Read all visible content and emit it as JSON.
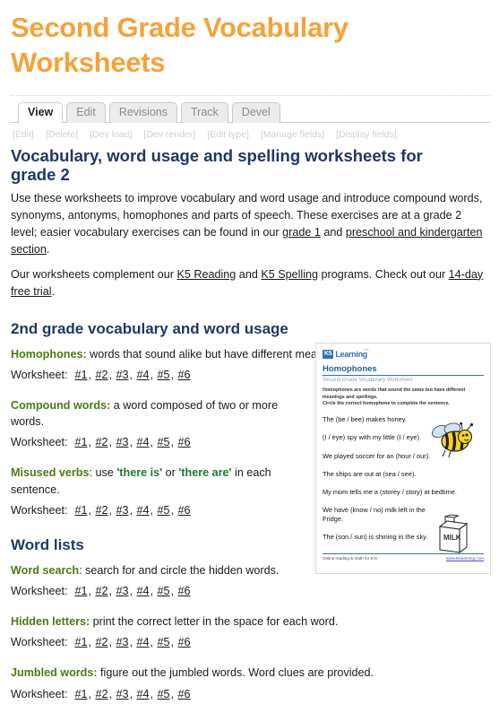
{
  "page_title": "Second Grade Vocabulary Worksheets",
  "tabs": [
    {
      "label": "View",
      "active": true
    },
    {
      "label": "Edit",
      "active": false
    },
    {
      "label": "Revisions",
      "active": false
    },
    {
      "label": "Track",
      "active": false
    },
    {
      "label": "Devel",
      "active": false
    }
  ],
  "admin_links": [
    "[Edit]",
    "[Delete]",
    "[Dev load]",
    "[Dev render]",
    "[Edit type]",
    "[Manage fields]",
    "[Display fields]"
  ],
  "sub_title": "Vocabulary, word usage and spelling worksheets for grade 2",
  "intro": {
    "part1": "Use these worksheets to improve vocabulary and word usage and introduce compound words, synonyms, antonyms, homophones and parts of speech.  These exercises are at a grade 2 level; easier vocabulary exercises can be found in our ",
    "link1": "grade 1",
    "part2": " and ",
    "link2": "preschool and kindergarten section",
    "part3": "."
  },
  "intro2": {
    "part1": "Our worksheets complement our ",
    "link1": "K5 Reading",
    "part2": " and ",
    "link2": "K5 Spelling",
    "part3": " programs. Check out our ",
    "link3": "14-day free trial",
    "part4": "."
  },
  "sections": [
    {
      "heading": "2nd grade vocabulary and word usage",
      "blocks": [
        {
          "label": "Homophones:",
          "desc": " words that sound alike but have different meanings and are spelled differently.",
          "wide": true,
          "worksheet_label": "Worksheet:",
          "links": [
            "#1",
            "#2",
            "#3",
            "#4",
            "#5",
            "#6"
          ]
        },
        {
          "label": "Compound words:",
          "desc": " a word composed of two or more words.",
          "wide": false,
          "worksheet_label": "Worksheet:",
          "links": [
            "#1",
            "#2",
            "#3",
            "#4",
            "#5",
            "#6"
          ]
        },
        {
          "label": "Misused verbs",
          "desc_a": ": use ",
          "quote1": "'there is'",
          "desc_b": " or ",
          "quote2": "'there are'",
          "desc_c": " in each sentence.",
          "wide": false,
          "worksheet_label": "Worksheet:",
          "links": [
            "#1",
            "#2",
            "#3",
            "#4",
            "#5",
            "#6"
          ]
        }
      ]
    },
    {
      "heading": "Word lists",
      "blocks": [
        {
          "label": "Word search",
          "desc": ": search for and circle the hidden words.",
          "wide": false,
          "worksheet_label": "Worksheet:",
          "links": [
            "#1",
            "#2",
            "#3",
            "#4",
            "#5",
            "#6"
          ]
        },
        {
          "label": "Hidden letters:",
          "desc": " print the correct letter in the space for each word.",
          "wide": true,
          "worksheet_label": "Worksheet:",
          "links": [
            "#1",
            "#2",
            "#3",
            "#4",
            "#5",
            "#6"
          ]
        },
        {
          "label": "Jumbled words:",
          "desc": " figure out the jumbled words. Word clues are provided.",
          "wide": true,
          "worksheet_label": "Worksheet:",
          "links": [
            "#1",
            "#2",
            "#3",
            "#4",
            "#5",
            "#6"
          ]
        }
      ]
    }
  ],
  "thumbnail": {
    "logo_badge": "K5",
    "logo_word": "Learning",
    "title": "Homophones",
    "subtitle": "Second Grade Vocabulary Worksheet",
    "instructions": "Homophones are words that sound the same but have different meanings and spellings.\nCircle the correct homophone to complete the sentence.",
    "questions": [
      "The (be / bee) makes honey.",
      "(I / eye) spy with my little (I / eye).",
      "We played soccer for an (hour / our).",
      "The ships are out at (sea / see).",
      "My mom tells me a (storey / story) at bedtime.",
      "We have (know / no) milk left in the Fridge.",
      "The (son / sun) is shining in the sky."
    ],
    "footer_left": "Online reading & math for K-5",
    "footer_right": "www.k5learning.com",
    "milk_label": "MILK"
  },
  "colors": {
    "title_orange": "#f5a23c",
    "heading_navy": "#1f3864",
    "label_olive": "#4d7a16",
    "green": "#1a7a2e",
    "logo_blue": "#2d6fb5"
  }
}
